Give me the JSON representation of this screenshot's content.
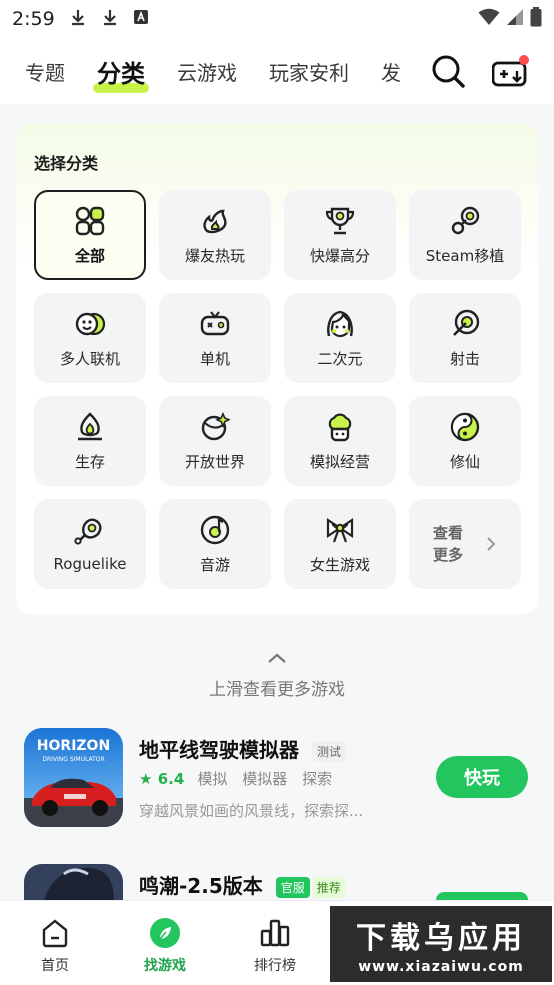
{
  "status_bar": {
    "time": "2:59"
  },
  "nav": {
    "tabs": [
      {
        "label": "专题"
      },
      {
        "label": "分类"
      },
      {
        "label": "云游戏"
      },
      {
        "label": "玩家安利"
      },
      {
        "label": "发"
      }
    ],
    "active_tab": "分类",
    "search_icon": "search-icon",
    "download_icon": "gamepad-download-icon"
  },
  "category_panel": {
    "title": "选择分类",
    "items": [
      {
        "label": "全部",
        "icon": "grid-icon",
        "selected": true
      },
      {
        "label": "爆友热玩",
        "icon": "fire-icon"
      },
      {
        "label": "快爆高分",
        "icon": "trophy-icon"
      },
      {
        "label": "Steam移植",
        "icon": "steam-icon"
      },
      {
        "label": "多人联机",
        "icon": "multiplayer-icon"
      },
      {
        "label": "单机",
        "icon": "gamepad-icon"
      },
      {
        "label": "二次元",
        "icon": "anime-girl-icon"
      },
      {
        "label": "射击",
        "icon": "target-icon"
      },
      {
        "label": "生存",
        "icon": "campfire-icon"
      },
      {
        "label": "开放世界",
        "icon": "planet-icon"
      },
      {
        "label": "模拟经营",
        "icon": "chef-hat-icon"
      },
      {
        "label": "修仙",
        "icon": "yin-yang-icon"
      },
      {
        "label": "Roguelike",
        "icon": "meat-icon"
      },
      {
        "label": "音游",
        "icon": "music-disc-icon"
      },
      {
        "label": "女生游戏",
        "icon": "bow-icon"
      }
    ],
    "more_label": "查看更多"
  },
  "scroll_hint": {
    "text": "上滑查看更多游戏"
  },
  "games": [
    {
      "name": "地平线驾驶模拟器",
      "tags": [
        "测试"
      ],
      "rating": "6.4",
      "keywords": [
        "模拟",
        "模拟器",
        "探索"
      ],
      "description": "穿越风景如画的风景线，探索探...",
      "button": "快玩",
      "icon_text": "HORIZON",
      "icon_subtext": "DRIVING SIMULATOR"
    },
    {
      "name": "鸣潮-2.5版本",
      "tags": [
        "官服",
        "推荐"
      ]
    }
  ],
  "bottom_nav": [
    {
      "label": "首页",
      "icon": "home-icon"
    },
    {
      "label": "找游戏",
      "icon": "compass-leaf-icon",
      "active": true
    },
    {
      "label": "排行榜",
      "icon": "bar-chart-icon"
    }
  ],
  "watermark": {
    "title": "下载乌应用",
    "subtitle": "www.xiazaiwu.com"
  },
  "colors": {
    "accent": "#22c55e",
    "highlight": "#c7f34a"
  }
}
